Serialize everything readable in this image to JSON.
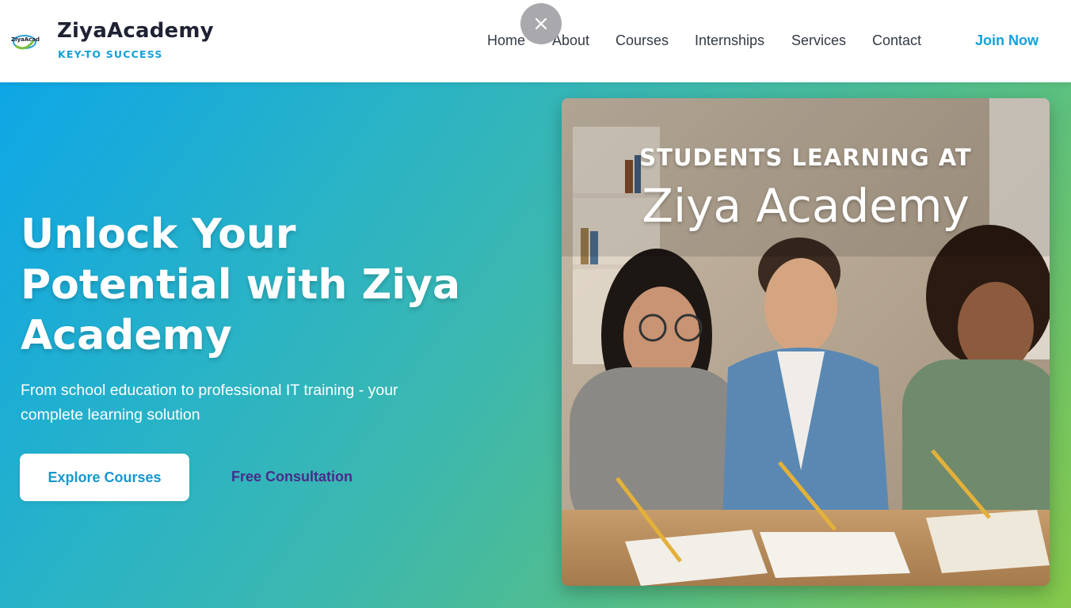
{
  "header": {
    "brand_name": "ZiyaAcademy",
    "brand_tagline": "KEY-TO SUCCESS",
    "logo_text": "ZiyaAcademy",
    "nav": [
      {
        "label": "Home"
      },
      {
        "label": "About"
      },
      {
        "label": "Courses"
      },
      {
        "label": "Internships"
      },
      {
        "label": "Services"
      },
      {
        "label": "Contact"
      }
    ],
    "join_label": "Join Now"
  },
  "overlay": {
    "close_icon": "close-icon"
  },
  "hero": {
    "title": "Unlock Your Potential with Ziya Academy",
    "subtitle": "From school education to professional IT training - your complete learning solution",
    "explore_label": "Explore Courses",
    "consult_label": "Free Consultation",
    "image": {
      "kicker": "STUDENTS LEARNING AT",
      "title": "Ziya Academy"
    }
  },
  "colors": {
    "accent": "#12a1df",
    "consult": "#4b2a8a",
    "gradient_start": "#0ea6e6",
    "gradient_end": "#86c84a"
  }
}
